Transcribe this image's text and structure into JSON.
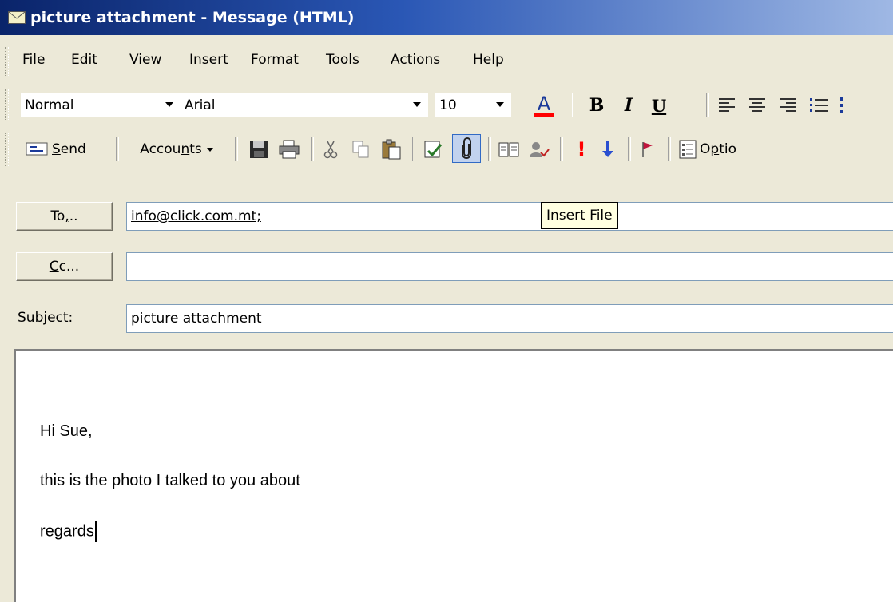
{
  "window": {
    "title": "picture attachment - Message (HTML)"
  },
  "menu": [
    {
      "label": "File",
      "key": "F",
      "rest": "ile"
    },
    {
      "label": "Edit",
      "key": "E",
      "rest": "dit"
    },
    {
      "label": "View",
      "key": "V",
      "rest": "iew"
    },
    {
      "label": "Insert",
      "key": "I",
      "rest": "nsert"
    },
    {
      "label": "Format",
      "pre": "F",
      "key": "o",
      "rest": "rmat"
    },
    {
      "label": "Tools",
      "key": "T",
      "rest": "ools"
    },
    {
      "label": "Actions",
      "key": "A",
      "rest": "ctions"
    },
    {
      "label": "Help",
      "key": "H",
      "rest": "elp"
    }
  ],
  "format_toolbar": {
    "style": "Normal",
    "font": "Arial",
    "size": "10"
  },
  "standard_toolbar": {
    "send_pre": "",
    "send_key": "S",
    "send_rest": "end",
    "accounts_pre": "Accou",
    "accounts_key": "n",
    "accounts_rest": "ts",
    "options_pre": "O",
    "options_key": "p",
    "options_rest": "tio"
  },
  "tooltip": "Insert File",
  "to": {
    "button_pre": "To",
    "button_key": ",",
    "button_rest": "..",
    "value": "info@click.com.mt;"
  },
  "cc": {
    "button_key": "C",
    "button_rest": "c...",
    "value": ""
  },
  "subject": {
    "label": "Subject:",
    "value": "picture attachment"
  },
  "body": {
    "line1": "Hi Sue,",
    "line2": "this is the photo I talked to you about",
    "line3": "regards"
  },
  "colors": {
    "title_start": "#0a246a",
    "title_end": "#9fb8e4",
    "chrome": "#ece9d8",
    "font_color_bar": "#ff0000",
    "importance_high": "#ff0000",
    "importance_low": "#2a4fd0"
  }
}
